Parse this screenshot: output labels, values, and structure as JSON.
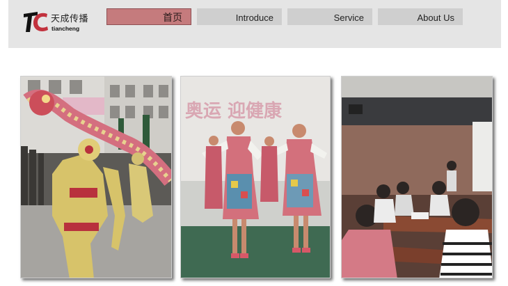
{
  "brand": {
    "name_cn": "天成传播",
    "name_en": "tiancheng"
  },
  "nav": {
    "items": [
      {
        "label": "首页",
        "active": true
      },
      {
        "label": "Introduce",
        "active": false
      },
      {
        "label": "Service",
        "active": false
      },
      {
        "label": "About Us",
        "active": false
      }
    ]
  },
  "photos": [
    {
      "subject": "dragon dance parade"
    },
    {
      "subject": "folk dancers performance",
      "banner_text": "奥运  迎健康"
    },
    {
      "subject": "conference room meeting"
    }
  ],
  "colors": {
    "header_bg": "#e5e5e5",
    "nav_bg": "#cfcfcf",
    "nav_active_bg": "#c57b7d",
    "logo_red": "#c2323e"
  }
}
